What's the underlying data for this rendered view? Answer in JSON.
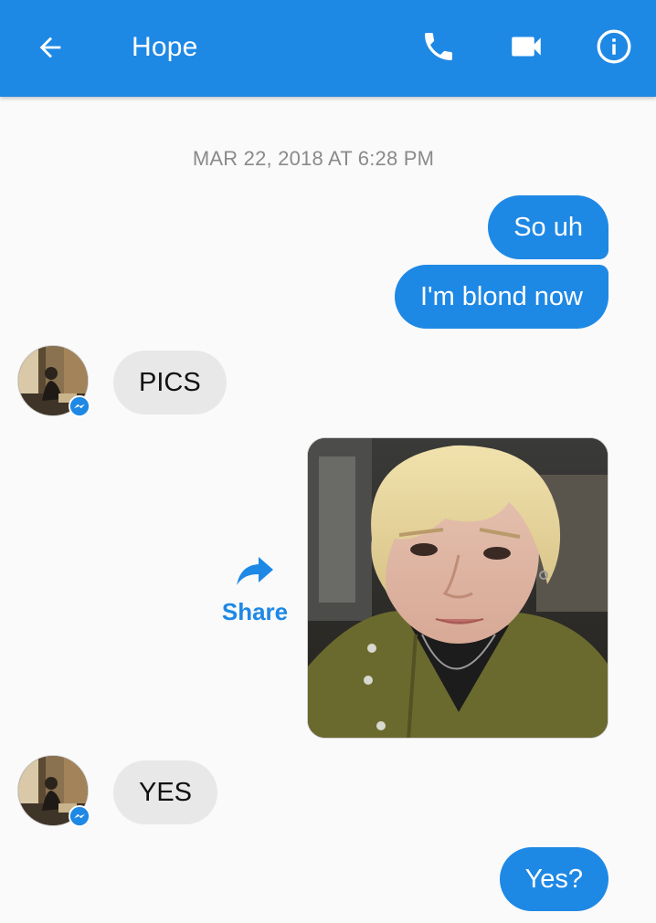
{
  "header": {
    "title": "Hope",
    "background_color": "#1e88e5",
    "icons": {
      "back": "arrow-left-icon",
      "call": "phone-icon",
      "video": "video-camera-icon",
      "info": "info-icon"
    }
  },
  "conversation": {
    "timestamp": "MAR 22, 2018 AT 6:28 PM",
    "messages": [
      {
        "direction": "outgoing",
        "text": "So uh"
      },
      {
        "direction": "outgoing",
        "text": "I'm blond now"
      },
      {
        "direction": "incoming",
        "text": "PICS"
      },
      {
        "direction": "outgoing",
        "type": "image"
      },
      {
        "direction": "incoming",
        "text": "YES"
      },
      {
        "direction": "outgoing",
        "text": "Yes?"
      }
    ],
    "share_label": "Share"
  },
  "colors": {
    "outgoing_bubble": "#1e88e5",
    "incoming_bubble": "#e8e8e8",
    "accent": "#1e88e5",
    "timestamp_text": "#8a8a8a"
  }
}
